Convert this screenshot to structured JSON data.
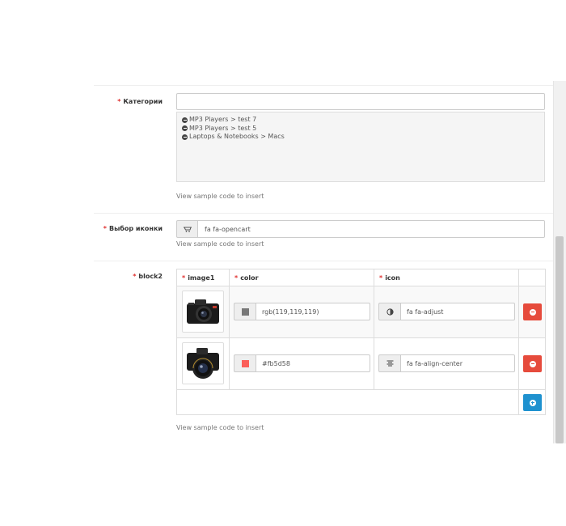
{
  "form": {
    "categories": {
      "label": "Категории",
      "input_value": "",
      "items": [
        "MP3 Players > test 7",
        "MP3 Players > test 5",
        "Laptops & Notebooks > Macs"
      ],
      "help": "View sample code to insert"
    },
    "icon_select": {
      "label": "Выбор иконки",
      "value": "fa fa-opencart",
      "help": "View sample code to insert"
    },
    "block2": {
      "label": "block2",
      "headers": {
        "image": "image1",
        "color": "color",
        "icon": "icon"
      },
      "rows": [
        {
          "image": "camera-icon",
          "color": "rgb(119,119,119)",
          "swatch": "#777777",
          "icon": "fa fa-adjust",
          "icon_glyph": "adjust-icon"
        },
        {
          "image": "camera-icon",
          "color": "#fb5d58",
          "swatch": "#fb5d58",
          "icon": "fa fa-align-center",
          "icon_glyph": "align-center-icon"
        }
      ],
      "help": "View sample code to insert"
    }
  },
  "colors": {
    "required": "#e0302f",
    "danger": "#e64b3c",
    "primary": "#1e91cf"
  }
}
